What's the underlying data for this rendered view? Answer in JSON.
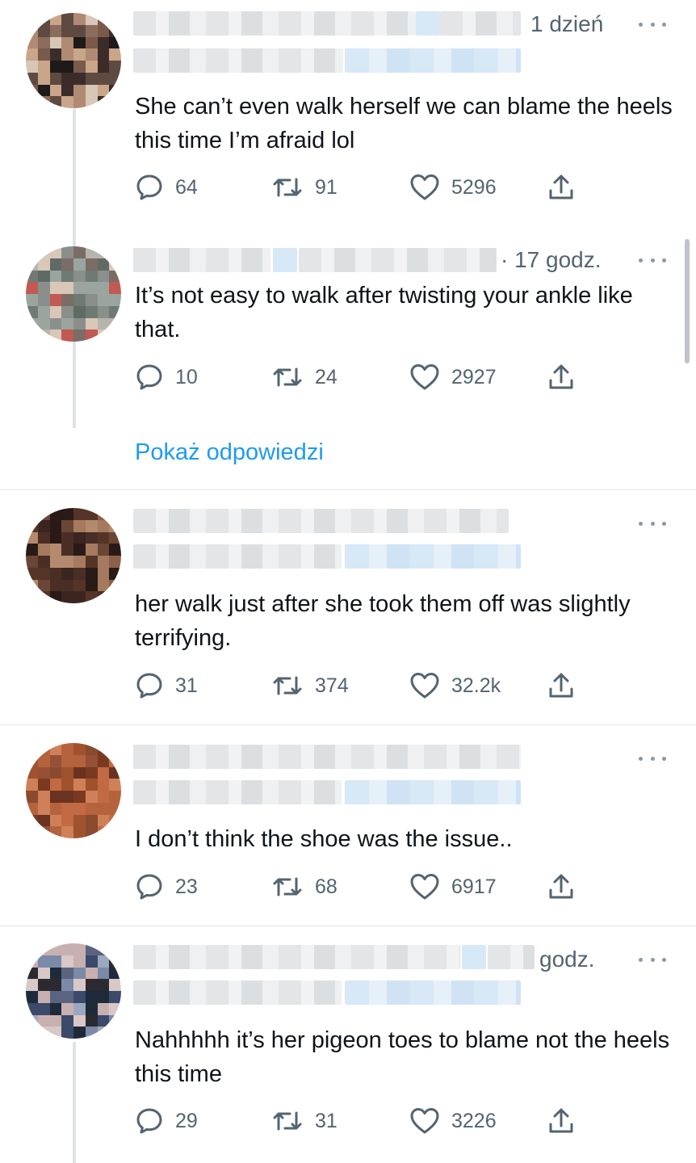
{
  "tweets": [
    {
      "time": "1 dzień",
      "text": "She can’t even walk herself we can blame the heels this time I’m afraid lol",
      "replies": "64",
      "retweets": "91",
      "likes": "5296"
    },
    {
      "time": "· 17 godz.",
      "text": "It’s not easy to walk after twisting your ankle like that.",
      "replies": "10",
      "retweets": "24",
      "likes": "2927"
    },
    {
      "time": "",
      "text": "her walk just after she took them off was slightly terrifying.",
      "replies": "31",
      "retweets": "374",
      "likes": "32.2k"
    },
    {
      "time": "",
      "text": "I don’t think the shoe was the issue..",
      "replies": "23",
      "retweets": "68",
      "likes": "6917"
    },
    {
      "time": "godz.",
      "text": "Nahhhhh it’s her pigeon toes to blame not the heels this time",
      "replies": "29",
      "retweets": "31",
      "likes": "3226"
    }
  ],
  "show_replies_label": "Pokaż odpowiedzi",
  "icons": {
    "reply": "reply-icon",
    "retweet": "retweet-icon",
    "like": "heart-icon",
    "share": "share-icon",
    "more": "more-options-icon"
  },
  "colors": {
    "text": "#0f1419",
    "secondary": "#536471",
    "accent": "#1d9bf0",
    "divider": "#e1e4e8"
  }
}
